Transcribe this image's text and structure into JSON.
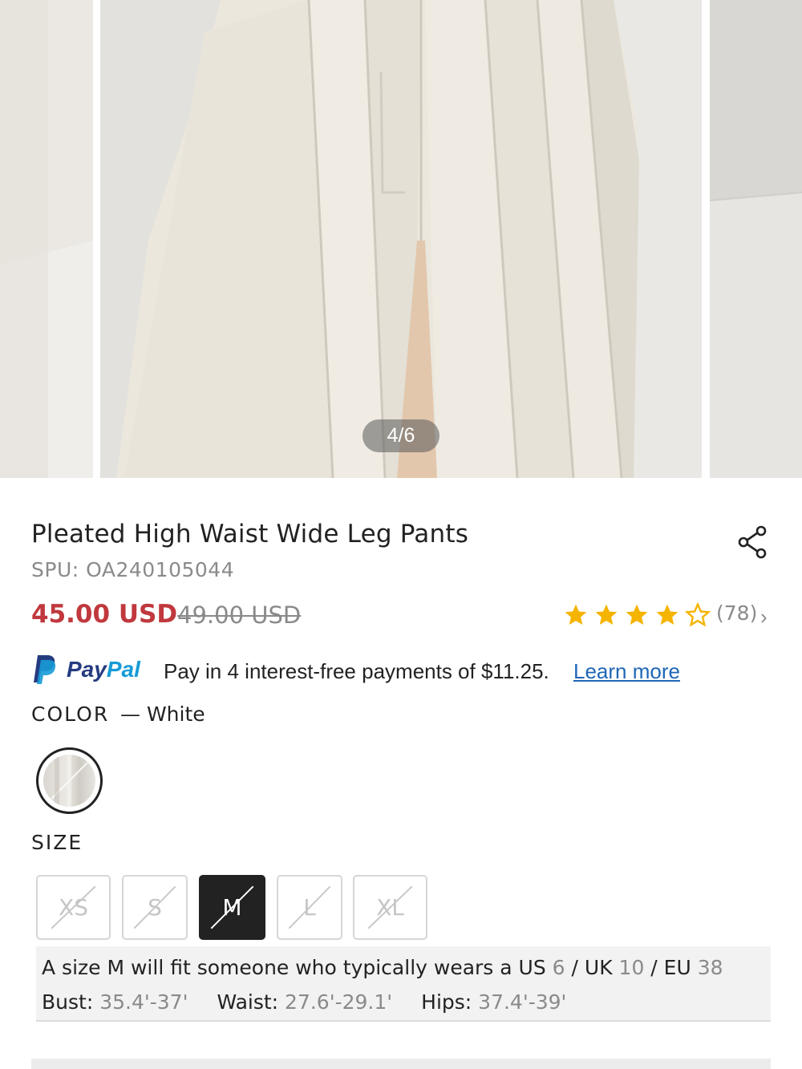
{
  "gallery": {
    "counter": "4/6"
  },
  "product": {
    "title": "Pleated High Waist Wide Leg Pants",
    "spu": "SPU: OA240105044",
    "price": "45.00 USD",
    "original_price": "49.00 USD",
    "rating": 4,
    "rating_max": 5,
    "reviews": "(78)",
    "colors": {
      "star": "#f5b400",
      "price": "#c0383d"
    }
  },
  "paypal": {
    "pay": "Pay",
    "pal": "Pal",
    "message": "Pay in 4 interest-free payments of $11.25.",
    "link": "Learn more"
  },
  "color": {
    "label": "COLOR",
    "value": "— White"
  },
  "size": {
    "label": "SIZE",
    "options": [
      "XS",
      "S",
      "M",
      "L",
      "XL"
    ],
    "selected": "M"
  },
  "fit": {
    "line1_prefix": "A size M will fit someone who typically wears a US ",
    "us": "6",
    "sep1": " / UK ",
    "uk": "10",
    "sep2": " / EU ",
    "eu": "38",
    "bust_label": "Bust: ",
    "bust": "35.4'-37'",
    "waist_label": "Waist: ",
    "waist": "27.6'-29.1'",
    "hips_label": "Hips: ",
    "hips": "37.4'-39'"
  }
}
